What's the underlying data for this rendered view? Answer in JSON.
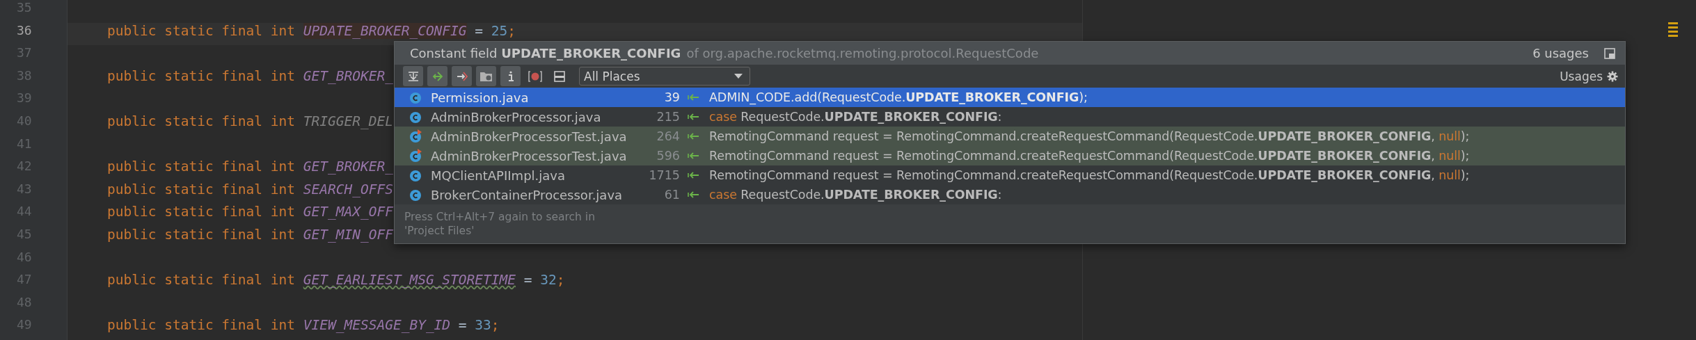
{
  "editor": {
    "lines": [
      {
        "number": "35",
        "current": false
      },
      {
        "number": "36",
        "current": true,
        "keywords": "public static final int",
        "name": "UPDATE_BROKER_CONFIG",
        "highlighted": true,
        "assign": "=",
        "value": "25",
        "end": ";"
      },
      {
        "number": "37",
        "current": false
      },
      {
        "number": "38",
        "current": false,
        "keywords": "public static final int",
        "name": "GET_BROKER_"
      },
      {
        "number": "39",
        "current": false
      },
      {
        "number": "40",
        "current": false,
        "keywords": "public static final int",
        "name": "TRIGGER_DEL",
        "unused": true
      },
      {
        "number": "41",
        "current": false
      },
      {
        "number": "42",
        "current": false,
        "keywords": "public static final int",
        "name": "GET_BROKER_"
      },
      {
        "number": "43",
        "current": false,
        "keywords": "public static final int",
        "name": "SEARCH_OFFS"
      },
      {
        "number": "44",
        "current": false,
        "keywords": "public static final int",
        "name": "GET_MAX_OFF"
      },
      {
        "number": "45",
        "current": false,
        "keywords": "public static final int",
        "name": "GET_MIN_OFF"
      },
      {
        "number": "46",
        "current": false
      },
      {
        "number": "47",
        "current": false,
        "keywords": "public static final int",
        "name": "GET_EARLIEST_MSG_STORETIME",
        "typo": true,
        "assign": "=",
        "value": "32",
        "end": ";"
      },
      {
        "number": "48",
        "current": false
      },
      {
        "number": "49",
        "current": false,
        "keywords": "public static final int",
        "name": "VIEW_MESSAGE_BY_ID",
        "assign": "=",
        "value": "33",
        "end": ";"
      }
    ]
  },
  "popup": {
    "title": "Constant field **UPDATE_BROKER_CONFIG**",
    "context": "of org.apache.rocketmq.remoting.protocol.RequestCode",
    "count": "6 usages",
    "scope": "All Places",
    "group_label": "Usages",
    "rows": [
      {
        "file": "Permission.java",
        "line": "39",
        "selected": true,
        "test": false,
        "code": [
          {
            "kind": "plain",
            "text": "ADMIN_CODE.add(RequestCode."
          },
          {
            "kind": "bold",
            "text": "UPDATE_BROKER_CONFIG"
          },
          {
            "kind": "plain",
            "text": ");"
          }
        ]
      },
      {
        "file": "AdminBrokerProcessor.java",
        "line": "215",
        "selected": false,
        "test": false,
        "code": [
          {
            "kind": "keyword",
            "text": "case"
          },
          {
            "kind": "plain",
            "text": " RequestCode."
          },
          {
            "kind": "bold",
            "text": "UPDATE_BROKER_CONFIG"
          },
          {
            "kind": "plain",
            "text": ":"
          }
        ]
      },
      {
        "file": "AdminBrokerProcessorTest.java",
        "line": "264",
        "selected": false,
        "test": true,
        "code": [
          {
            "kind": "plain",
            "text": "RemotingCommand request = RemotingCommand.createRequestCommand(RequestCode."
          },
          {
            "kind": "bold",
            "text": "UPDATE_BROKER_CONFIG"
          },
          {
            "kind": "plain",
            "text": ", "
          },
          {
            "kind": "keyword",
            "text": "null"
          },
          {
            "kind": "plain",
            "text": ");"
          }
        ]
      },
      {
        "file": "AdminBrokerProcessorTest.java",
        "line": "596",
        "selected": false,
        "test": true,
        "code": [
          {
            "kind": "plain",
            "text": "RemotingCommand request = RemotingCommand.createRequestCommand(RequestCode."
          },
          {
            "kind": "bold",
            "text": "UPDATE_BROKER_CONFIG"
          },
          {
            "kind": "plain",
            "text": ", "
          },
          {
            "kind": "keyword",
            "text": "null"
          },
          {
            "kind": "plain",
            "text": ");"
          }
        ]
      },
      {
        "file": "MQClientAPIImpl.java",
        "line": "1715",
        "selected": false,
        "test": false,
        "code": [
          {
            "kind": "plain",
            "text": "RemotingCommand request = RemotingCommand.createRequestCommand(RequestCode."
          },
          {
            "kind": "bold",
            "text": "UPDATE_BROKER_CONFIG"
          },
          {
            "kind": "plain",
            "text": ", "
          },
          {
            "kind": "keyword",
            "text": "null"
          },
          {
            "kind": "plain",
            "text": ");"
          }
        ]
      },
      {
        "file": "BrokerContainerProcessor.java",
        "line": "61",
        "selected": false,
        "test": false,
        "code": [
          {
            "kind": "keyword",
            "text": "case"
          },
          {
            "kind": "plain",
            "text": " RequestCode."
          },
          {
            "kind": "bold",
            "text": "UPDATE_BROKER_CONFIG"
          },
          {
            "kind": "plain",
            "text": ":"
          }
        ]
      }
    ],
    "hint": "Press Ctrl+Alt+7 again to search in 'Project Files'"
  }
}
